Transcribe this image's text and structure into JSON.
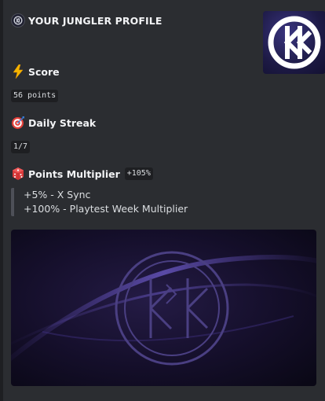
{
  "embed": {
    "title": "YOUR JUNGLER PROFILE",
    "author_icon": "junglerz-logo-icon",
    "thumbnail_icon": "junglerz-logo-icon"
  },
  "fields": [
    {
      "icon": "lightning-icon",
      "name": "Score",
      "value": "56 points"
    },
    {
      "icon": "target-icon",
      "name": "Daily Streak",
      "value": "1/7"
    },
    {
      "icon": "dice-icon",
      "name": "Points Multiplier",
      "badge": "+105%"
    }
  ],
  "multiplier_lines": [
    "+5% - X Sync",
    "+100% - Playtest Week Multiplier"
  ],
  "banner_icon": "junglerz-logo-icon",
  "colors": {
    "embed_bg": "#2b2d31",
    "accent_purple": "#2a1f4a"
  }
}
